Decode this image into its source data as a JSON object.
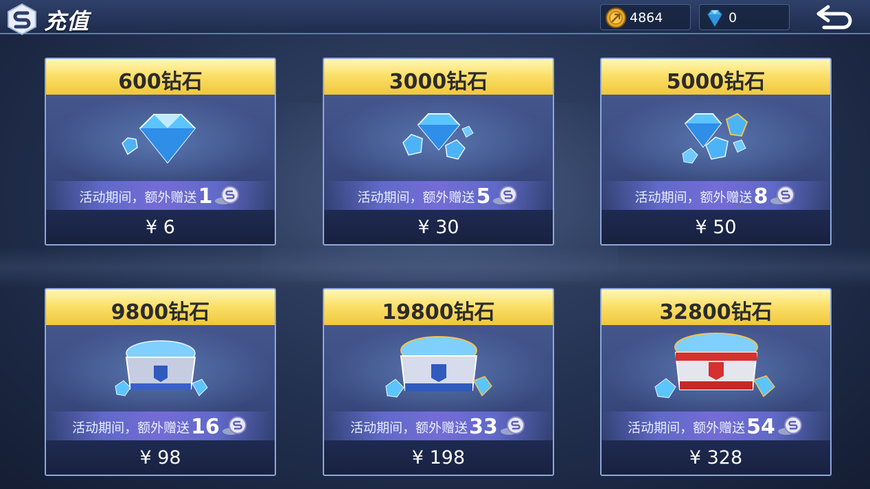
{
  "header": {
    "title": "充值",
    "coin_amount": "4864",
    "gem_amount": "0"
  },
  "icons": {
    "logo": "s-logo-icon",
    "coin": "gold-coin-icon",
    "gem": "diamond-icon",
    "back": "back-arrow-icon",
    "bonus": "s-coin-icon"
  },
  "colors": {
    "header_accent": "#5d7bb8",
    "card_title_gold": "#fbe06a",
    "promo_purple": "#7a6edc"
  },
  "packages": [
    {
      "title": "600钻石",
      "promo_text": "活动期间，额外赠送",
      "bonus": "1",
      "price": "¥ 6"
    },
    {
      "title": "3000钻石",
      "promo_text": "活动期间，额外赠送",
      "bonus": "5",
      "price": "¥ 30"
    },
    {
      "title": "5000钻石",
      "promo_text": "活动期间，额外赠送",
      "bonus": "8",
      "price": "¥ 50"
    },
    {
      "title": "9800钻石",
      "promo_text": "活动期间，额外赠送",
      "bonus": "16",
      "price": "¥ 98"
    },
    {
      "title": "19800钻石",
      "promo_text": "活动期间，额外赠送",
      "bonus": "33",
      "price": "¥ 198"
    },
    {
      "title": "32800钻石",
      "promo_text": "活动期间，额外赠送",
      "bonus": "54",
      "price": "¥ 328"
    }
  ]
}
